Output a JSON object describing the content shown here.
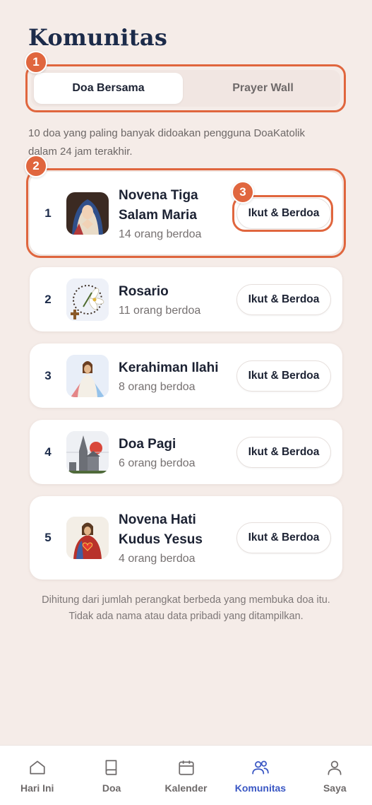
{
  "page": {
    "title": "Komunitas"
  },
  "segments": {
    "active": "Doa Bersama",
    "inactive": "Prayer Wall"
  },
  "description": "10 doa yang paling banyak didoakan pengguna DoaKatolik dalam 24 jam terakhir.",
  "annotations": [
    "1",
    "2",
    "3"
  ],
  "prayers": [
    {
      "rank": "1",
      "name": "Novena Tiga Salam Maria",
      "count": "14 orang berdoa",
      "button": "Ikut & Berdoa",
      "icon": "mary-icon"
    },
    {
      "rank": "2",
      "name": "Rosario",
      "count": "11 orang berdoa",
      "button": "Ikut & Berdoa",
      "icon": "rosary-icon"
    },
    {
      "rank": "3",
      "name": "Kerahiman Ilahi",
      "count": "8 orang berdoa",
      "button": "Ikut & Berdoa",
      "icon": "divine-mercy-icon"
    },
    {
      "rank": "4",
      "name": "Doa Pagi",
      "count": "6 orang berdoa",
      "button": "Ikut & Berdoa",
      "icon": "church-sunrise-icon"
    },
    {
      "rank": "5",
      "name": "Novena Hati Kudus Yesus",
      "count": "4 orang berdoa",
      "button": "Ikut & Berdoa",
      "icon": "sacred-heart-icon"
    }
  ],
  "footnote": "Dihitung dari jumlah perangkat berbeda yang membuka doa itu. Tidak ada nama atau data pribadi yang ditampilkan.",
  "nav": [
    {
      "label": "Hari Ini",
      "icon": "home-icon"
    },
    {
      "label": "Doa",
      "icon": "book-icon"
    },
    {
      "label": "Kalender",
      "icon": "calendar-icon"
    },
    {
      "label": "Komunitas",
      "icon": "community-icon",
      "active": true
    },
    {
      "label": "Saya",
      "icon": "profile-icon"
    }
  ],
  "colors": {
    "accent": "#e0663e",
    "activeNav": "#3a57c4",
    "background": "#f5ece8"
  }
}
